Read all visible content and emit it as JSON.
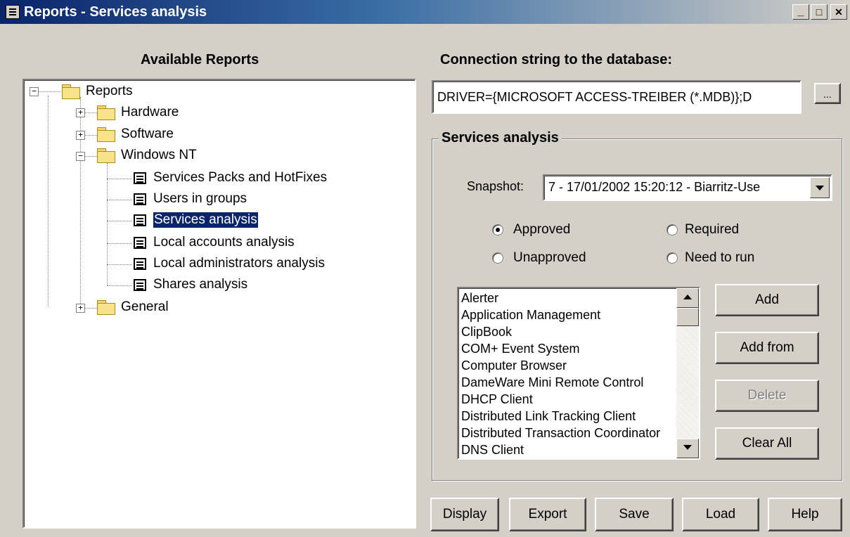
{
  "window": {
    "title": "Reports - Services analysis",
    "controls": {
      "minimize": "_",
      "maximize": "□",
      "close": "✕"
    }
  },
  "left": {
    "heading": "Available Reports",
    "tree": {
      "root": "Reports",
      "nodes": [
        "Hardware",
        "Software",
        "Windows NT",
        "General"
      ],
      "windows_nt_children": [
        "Services Packs and HotFixes",
        "Users in groups",
        "Services analysis",
        "Local accounts analysis",
        "Local administrators analysis",
        "Shares analysis"
      ],
      "selected": "Services analysis"
    }
  },
  "right": {
    "connection_label": "Connection string to the database:",
    "connection_value": "DRIVER={MICROSOFT ACCESS-TREIBER (*.MDB)};D",
    "browse_label": "...",
    "group_title": "Services analysis",
    "snapshot_label": "Snapshot:",
    "snapshot_value": "7 - 17/01/2002 15:20:12 - Biarritz-Use",
    "radios": {
      "approved": "Approved",
      "required": "Required",
      "unapproved": "Unapproved",
      "need_to_run": "Need to run",
      "selected": "approved"
    },
    "services": [
      "Alerter",
      "Application Management",
      "ClipBook",
      "COM+ Event System",
      "Computer Browser",
      "DameWare Mini Remote Control",
      "DHCP Client",
      "Distributed Link Tracking Client",
      "Distributed Transaction Coordinator",
      "DNS Client"
    ],
    "buttons": {
      "add": "Add",
      "add_from": "Add from",
      "delete": "Delete",
      "clear_all": "Clear All"
    }
  },
  "bottom_buttons": {
    "display": "Display",
    "export": "Export",
    "save": "Save",
    "load": "Load",
    "help": "Help"
  }
}
